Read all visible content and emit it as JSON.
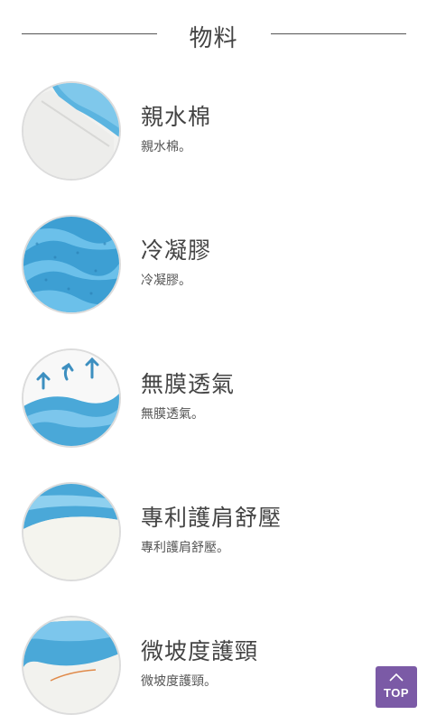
{
  "section": {
    "title": "物料"
  },
  "features": [
    {
      "icon": "cotton-layer-icon",
      "title": "親水棉",
      "description": "親水棉。"
    },
    {
      "icon": "cooling-gel-icon",
      "title": "冷凝膠",
      "description": "冷凝膠。"
    },
    {
      "icon": "breathable-film-icon",
      "title": "無膜透氣",
      "description": "無膜透氣。"
    },
    {
      "icon": "shoulder-relief-icon",
      "title": "專利護肩舒壓",
      "description": "專利護肩舒壓。"
    },
    {
      "icon": "neck-support-icon",
      "title": "微坡度護頸",
      "description": "微坡度護頸。"
    }
  ],
  "top_button": {
    "label": "TOP"
  },
  "colors": {
    "accent": "#7b5aa6",
    "gel_blue": "#4aa8d8",
    "text": "#444444"
  }
}
